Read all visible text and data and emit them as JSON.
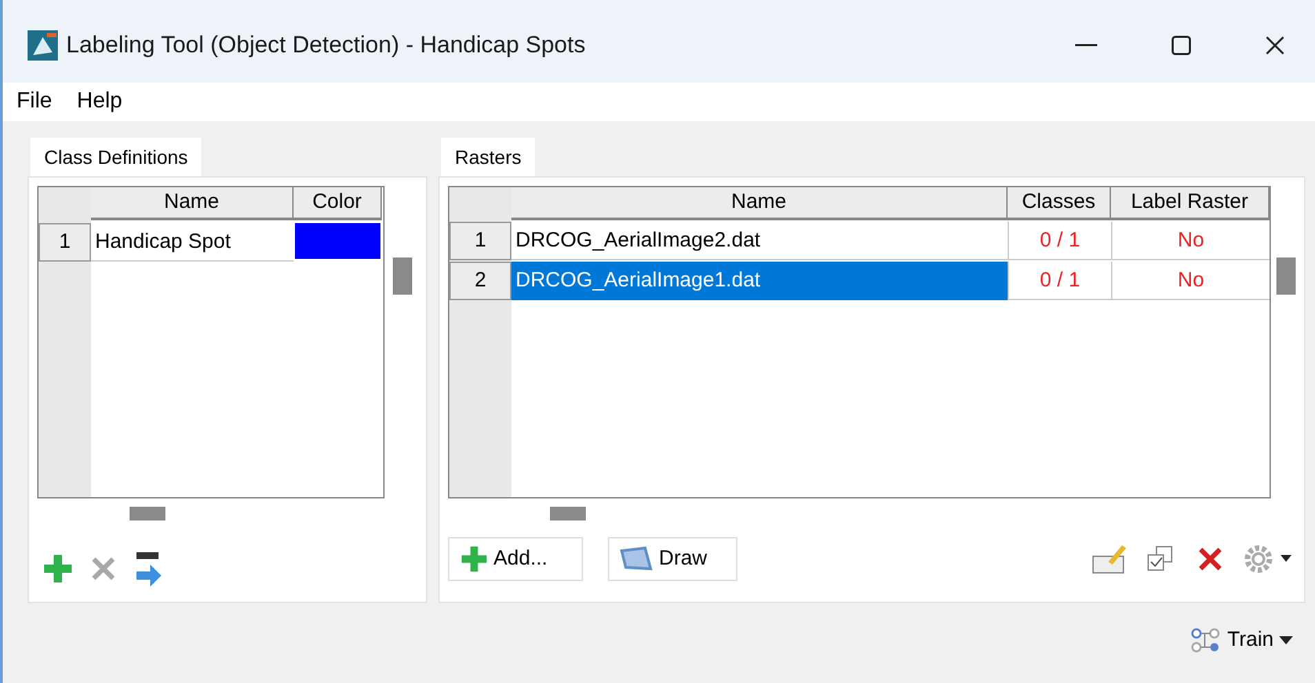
{
  "window": {
    "title": "Labeling Tool (Object Detection) - Handicap Spots"
  },
  "menu": [
    "File",
    "Help"
  ],
  "class_panel": {
    "tab": "Class Definitions",
    "columns": [
      "Name",
      "Color"
    ],
    "rows": [
      {
        "index": "1",
        "name": "Handicap Spot",
        "color": "#0000ff"
      }
    ]
  },
  "raster_panel": {
    "tab": "Rasters",
    "columns": [
      "Name",
      "Classes",
      "Label Raster"
    ],
    "rows": [
      {
        "index": "1",
        "name": "DRCOG_AerialImage2.dat",
        "classes": "0 / 1",
        "label_raster": "No",
        "selected": false
      },
      {
        "index": "2",
        "name": "DRCOG_AerialImage1.dat",
        "classes": "0 / 1",
        "label_raster": "No",
        "selected": true
      }
    ],
    "buttons": [
      "Add...",
      "Draw"
    ]
  },
  "train_button": "Train"
}
